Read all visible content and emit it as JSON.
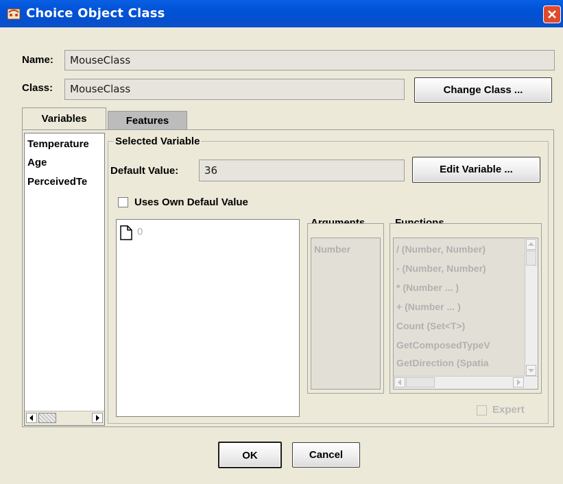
{
  "window": {
    "title": "Choice Object Class"
  },
  "name_row": {
    "label": "Name:",
    "value": "MouseClass"
  },
  "class_row": {
    "label": "Class:",
    "value": "MouseClass",
    "change_button": "Change Class ..."
  },
  "tabs": [
    {
      "label": "Variables",
      "active": true
    },
    {
      "label": "Features",
      "active": false
    }
  ],
  "variables": {
    "items": [
      "Temperature",
      "Age",
      "PerceivedTe"
    ]
  },
  "selected_variable": {
    "group_title": "Selected Variable",
    "default_label": "Default Value:",
    "default_value": "36",
    "edit_button": "Edit Variable ...",
    "uses_own_label": "Uses Own Defaul Value",
    "uses_own_checked": false,
    "tree_node": "0",
    "arguments_title": "Arguments",
    "arguments": [
      "Number"
    ],
    "functions_title": "Functions",
    "functions": [
      "/ (Number, Number)",
      "- (Number, Number)",
      "* (Number ... )",
      "+ (Number ... )",
      "Count (Set<T>)",
      "GetComposedTypeV",
      "GetDirection (Spatia"
    ],
    "expert_label": "Expert"
  },
  "footer": {
    "ok": "OK",
    "cancel": "Cancel"
  }
}
